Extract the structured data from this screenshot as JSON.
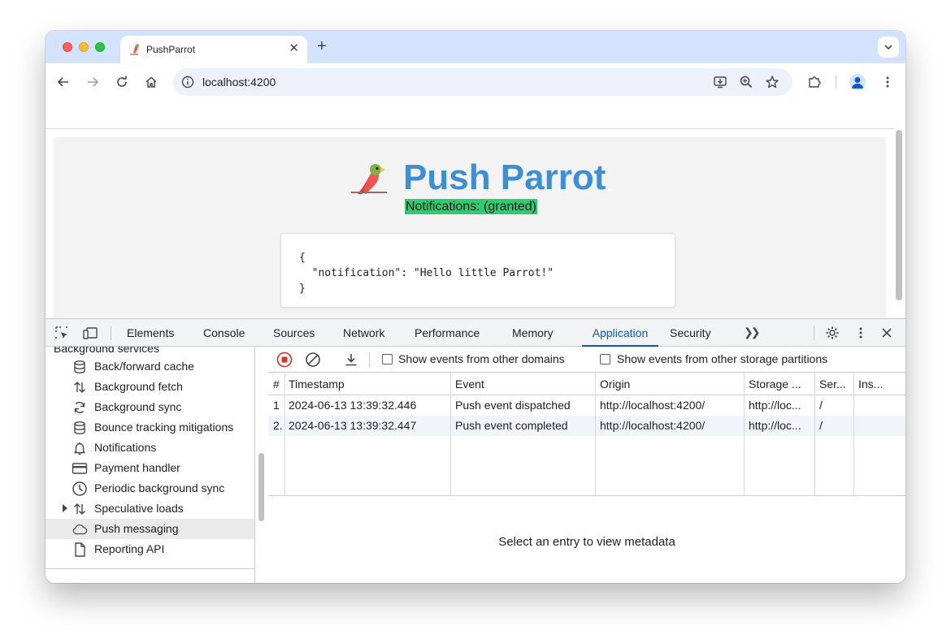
{
  "browser": {
    "tab_title": "PushParrot",
    "url": "localhost:4200"
  },
  "page": {
    "brand_title": "Push Parrot",
    "notification_status": "Notifications: (granted)",
    "payload_lines": [
      "{",
      "  \"notification\": \"Hello little Parrot!\"",
      "}"
    ],
    "status_color": "#2ecc71",
    "title_color": "#3a8fd6"
  },
  "devtools": {
    "tabs": [
      {
        "label": "Elements"
      },
      {
        "label": "Console"
      },
      {
        "label": "Sources"
      },
      {
        "label": "Network"
      },
      {
        "label": "Performance"
      },
      {
        "label": "Memory"
      },
      {
        "label": "Application"
      },
      {
        "label": "Security"
      }
    ],
    "active_tab": "Application",
    "sidebar": {
      "section_partial": "Background services",
      "items": [
        {
          "label": "Back/forward cache",
          "icon": "database-icon"
        },
        {
          "label": "Background fetch",
          "icon": "arrows-updown-icon"
        },
        {
          "label": "Background sync",
          "icon": "sync-icon"
        },
        {
          "label": "Bounce tracking mitigations",
          "icon": "database-icon"
        },
        {
          "label": "Notifications",
          "icon": "bell-icon"
        },
        {
          "label": "Payment handler",
          "icon": "card-icon"
        },
        {
          "label": "Periodic background sync",
          "icon": "clock-icon"
        },
        {
          "label": "Speculative loads",
          "icon": "arrows-updown-icon"
        },
        {
          "label": "Push messaging",
          "icon": "cloud-icon"
        },
        {
          "label": "Reporting API",
          "icon": "file-icon"
        }
      ]
    },
    "panel": {
      "checkbox_other_domains": "Show events from other domains",
      "checkbox_other_partitions": "Show events from other storage partitions",
      "columns": [
        "#",
        "Timestamp",
        "Event",
        "Origin",
        "Storage ...",
        "Ser...",
        "Ins..."
      ],
      "rows": [
        [
          "1",
          "2024-06-13 13:39:32.446",
          "Push event dispatched",
          "http://localhost:4200/",
          "http://loc...",
          "/",
          ""
        ],
        [
          "2.",
          "2024-06-13 13:39:32.447",
          "Push event completed",
          "http://localhost:4200/",
          "http://loc...",
          "/",
          ""
        ]
      ],
      "metadata_message": "Select an entry to view metadata"
    },
    "accent_color": "#0b57d0",
    "record_color": "#d93025"
  }
}
